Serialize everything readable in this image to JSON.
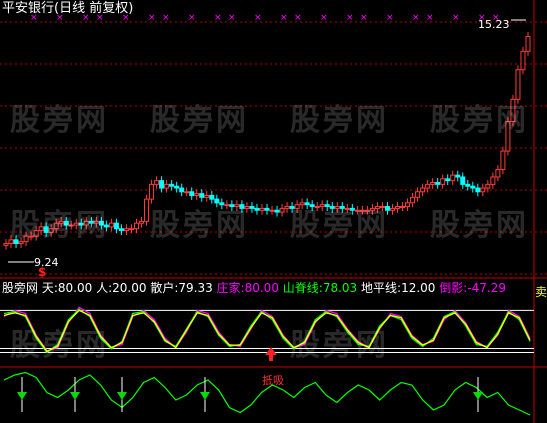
{
  "window": {
    "title": "平安银行(日线 前复权)"
  },
  "watermark": "股旁网",
  "info_bar": {
    "name": "股旁网",
    "items": [
      {
        "label": "天:",
        "value": "80.00",
        "color": "#ffffff"
      },
      {
        "label": "人:",
        "value": "20.00",
        "color": "#ffffff"
      },
      {
        "label": "散户:",
        "value": "79.33",
        "color": "#ffffff"
      },
      {
        "label": "庄家:",
        "value": "80.00",
        "color": "#ff00ff"
      },
      {
        "label": "山脊线:",
        "value": "78.03",
        "color": "#00ff00"
      },
      {
        "label": "地平线:",
        "value": "12.00",
        "color": "#ffffff"
      },
      {
        "label": "倒影:",
        "value": "-47.29",
        "color": "#ff00ff"
      }
    ]
  },
  "price_labels": {
    "high": "15.23",
    "low": "9.24"
  },
  "markers": {
    "sell_top": "卖",
    "buy_low": "$",
    "bottom_label": "抵吸"
  },
  "colors": {
    "up": "#ff3b3b",
    "down": "#00ffff",
    "grid": "#b00000",
    "magenta": "#ff00ff",
    "green": "#00ff00",
    "yellow": "#ffff00",
    "white": "#ffffff"
  },
  "chart_data": [
    {
      "type": "candlestick",
      "title": "平安银行(日线 前复权)",
      "x": [
        1,
        2,
        3,
        4,
        5,
        6,
        7,
        8,
        9,
        10,
        11,
        12,
        13,
        14,
        15,
        16,
        17,
        18,
        19,
        20,
        21,
        22,
        23,
        24,
        25,
        26,
        27,
        28,
        29,
        30,
        31,
        32,
        33,
        34,
        35,
        36,
        37,
        38,
        39,
        40,
        41,
        42,
        43,
        44,
        45,
        46,
        47,
        48,
        49,
        50,
        51,
        52,
        53,
        54,
        55,
        56,
        57,
        58,
        59,
        60,
        61,
        62,
        63,
        64,
        65,
        66,
        67,
        68,
        69,
        70,
        71,
        72,
        73,
        74,
        75,
        76,
        77,
        78,
        79,
        80,
        81,
        82,
        83,
        84,
        85,
        86,
        87,
        88,
        89,
        90,
        91,
        92,
        93,
        94,
        95,
        96,
        97,
        98,
        99,
        100,
        101,
        102,
        103,
        104,
        105
      ],
      "close": [
        9.5,
        9.6,
        9.5,
        9.55,
        9.7,
        9.7,
        9.85,
        9.95,
        9.8,
        9.9,
        10.05,
        10.1,
        10.0,
        10.0,
        10.05,
        10.0,
        10.1,
        10.05,
        10.1,
        10.0,
        9.95,
        10.05,
        9.9,
        9.85,
        9.9,
        9.9,
        10.05,
        10.1,
        10.7,
        11.1,
        11.2,
        11.0,
        11.1,
        11.05,
        11.0,
        10.9,
        10.9,
        10.8,
        10.85,
        10.75,
        10.8,
        10.7,
        10.6,
        10.55,
        10.55,
        10.5,
        10.55,
        10.45,
        10.5,
        10.45,
        10.4,
        10.45,
        10.4,
        10.4,
        10.35,
        10.45,
        10.5,
        10.45,
        10.55,
        10.6,
        10.55,
        10.5,
        10.5,
        10.55,
        10.5,
        10.45,
        10.5,
        10.45,
        10.45,
        10.4,
        10.4,
        10.4,
        10.4,
        10.45,
        10.5,
        10.5,
        10.4,
        10.45,
        10.5,
        10.5,
        10.6,
        10.75,
        10.9,
        11.0,
        11.1,
        11.15,
        11.1,
        11.25,
        11.2,
        11.35,
        11.3,
        11.1,
        11.05,
        11.0,
        10.9,
        11.0,
        11.1,
        11.3,
        11.5,
        12.0,
        12.8,
        13.4,
        14.2,
        14.7,
        15.1
      ],
      "price_high_label": 15.23,
      "price_low_label": 9.24
    },
    {
      "type": "line",
      "name": "oscillator",
      "series": [
        {
          "name": "庄家",
          "color": "#ff00ff",
          "values": [
            70,
            80,
            75,
            40,
            15,
            20,
            60,
            85,
            75,
            40,
            20,
            25,
            70,
            80,
            65,
            35,
            20,
            45,
            80,
            75,
            45,
            25,
            22,
            50,
            80,
            70,
            40,
            20,
            25,
            60,
            80,
            75,
            50,
            30,
            20,
            50,
            75,
            70,
            40,
            25,
            30,
            65,
            80,
            60,
            30,
            20,
            40,
            80,
            70,
            35
          ]
        },
        {
          "name": "山脊线",
          "color": "#00ff00",
          "values": [
            75,
            78,
            70,
            35,
            12,
            25,
            65,
            82,
            70,
            35,
            18,
            30,
            75,
            78,
            60,
            30,
            22,
            50,
            78,
            70,
            40,
            22,
            25,
            55,
            78,
            65,
            35,
            18,
            30,
            65,
            78,
            70,
            45,
            25,
            22,
            55,
            72,
            65,
            35,
            22,
            35,
            70,
            78,
            55,
            25,
            22,
            45,
            78,
            65,
            30
          ]
        },
        {
          "name": "散户",
          "color": "#ffff00",
          "values": [
            72,
            76,
            72,
            38,
            14,
            22,
            62,
            80,
            72,
            38,
            20,
            28,
            72,
            76,
            62,
            32,
            20,
            48,
            76,
            72,
            42,
            24,
            24,
            52,
            76,
            68,
            38,
            20,
            28,
            62,
            76,
            72,
            48,
            28,
            20,
            52,
            72,
            68,
            38,
            24,
            32,
            68,
            76,
            58,
            28,
            20,
            42,
            76,
            68,
            32
          ]
        }
      ],
      "horizon": 12.0,
      "sky": 80.0
    },
    {
      "type": "line",
      "name": "bottom",
      "series": [
        {
          "name": "倒影",
          "color": "#00ff00",
          "values": [
            -20,
            -10,
            -5,
            -15,
            -45,
            -55,
            -40,
            -20,
            -10,
            -30,
            -60,
            -75,
            -55,
            -25,
            -15,
            -35,
            -60,
            -50,
            -30,
            -20,
            -40,
            -75,
            -85,
            -70,
            -45,
            -30,
            -40,
            -55,
            -35,
            -25,
            -50,
            -65,
            -45,
            -30,
            -40,
            -60,
            -40,
            -25,
            -30,
            -60,
            -80,
            -70,
            -40,
            -25,
            -35,
            -55,
            -45,
            -70,
            -80,
            -90
          ]
        }
      ]
    }
  ]
}
